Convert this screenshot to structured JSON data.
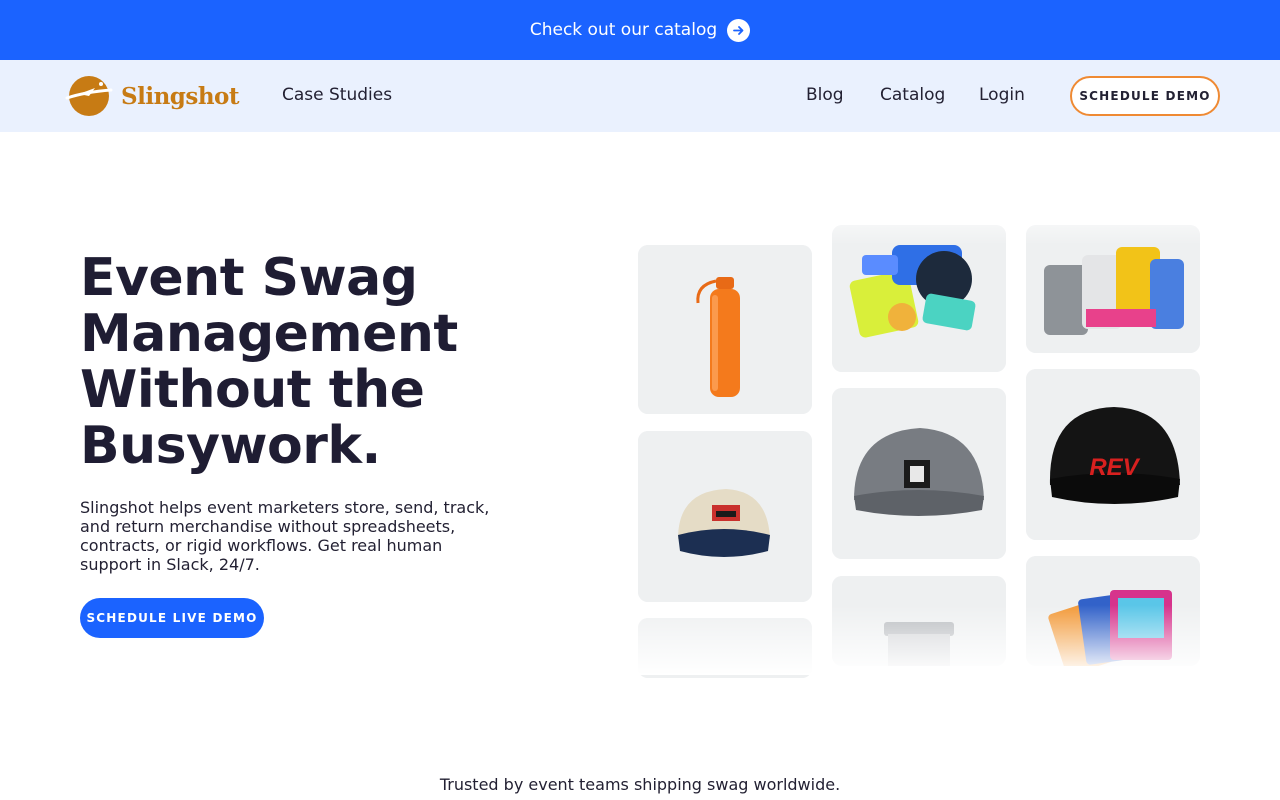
{
  "announcement": {
    "text": "Check out our catalog",
    "icon": "arrow-right-circle-icon"
  },
  "nav": {
    "brand": "Slingshot",
    "links": {
      "case_studies": "Case Studies",
      "blog": "Blog",
      "catalog": "Catalog",
      "login": "Login"
    },
    "cta": "SCHEDULE DEMO"
  },
  "hero": {
    "title_lines": [
      "Event Swag",
      "Management",
      "Without the",
      "Busywork."
    ],
    "description": "Slingshot helps event marketers store, send, track, and return merchandise without spreadsheets, contracts, or rigid workflows. Get real human support in Slack, 24/7.",
    "cta": "SCHEDULE LIVE DEMO",
    "gallery": {
      "items": [
        "orange water bottle",
        "sticker pack",
        "socks",
        "beige dad hat",
        "grey trucker cap",
        "black REV snapback cap",
        "insulated tumbler",
        "card sleeves"
      ],
      "cap_print": "REV"
    }
  },
  "trusted": "Trusted by event teams shipping swag worldwide.",
  "colors": {
    "primary": "#1b63ff",
    "nav_bg": "#eaf1fe",
    "brand": "#c77b14",
    "cta_border": "#ef8a33",
    "text": "#1f1d33"
  }
}
